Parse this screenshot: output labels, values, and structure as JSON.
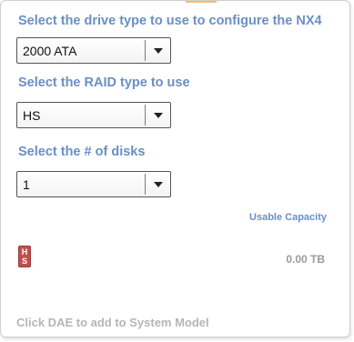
{
  "drive_type": {
    "label": "Select the drive type to use to configure the NX4",
    "selected": "2000 ATA"
  },
  "raid_type": {
    "label": "Select the RAID type to use",
    "selected": "HS"
  },
  "disk_count": {
    "label": "Select the # of disks",
    "selected": "1"
  },
  "capacity": {
    "header": "Usable Capacity",
    "badge_line1": "H",
    "badge_line2": "S",
    "value": "0.00 TB"
  },
  "footer": {
    "hint": "Click DAE to add to System Model"
  },
  "colors": {
    "label_blue": "#6a8fc4",
    "badge_red": "#c0504d",
    "muted_gray": "#b5b5b5"
  },
  "icons": {
    "dropdown": "chevron-down-icon"
  }
}
